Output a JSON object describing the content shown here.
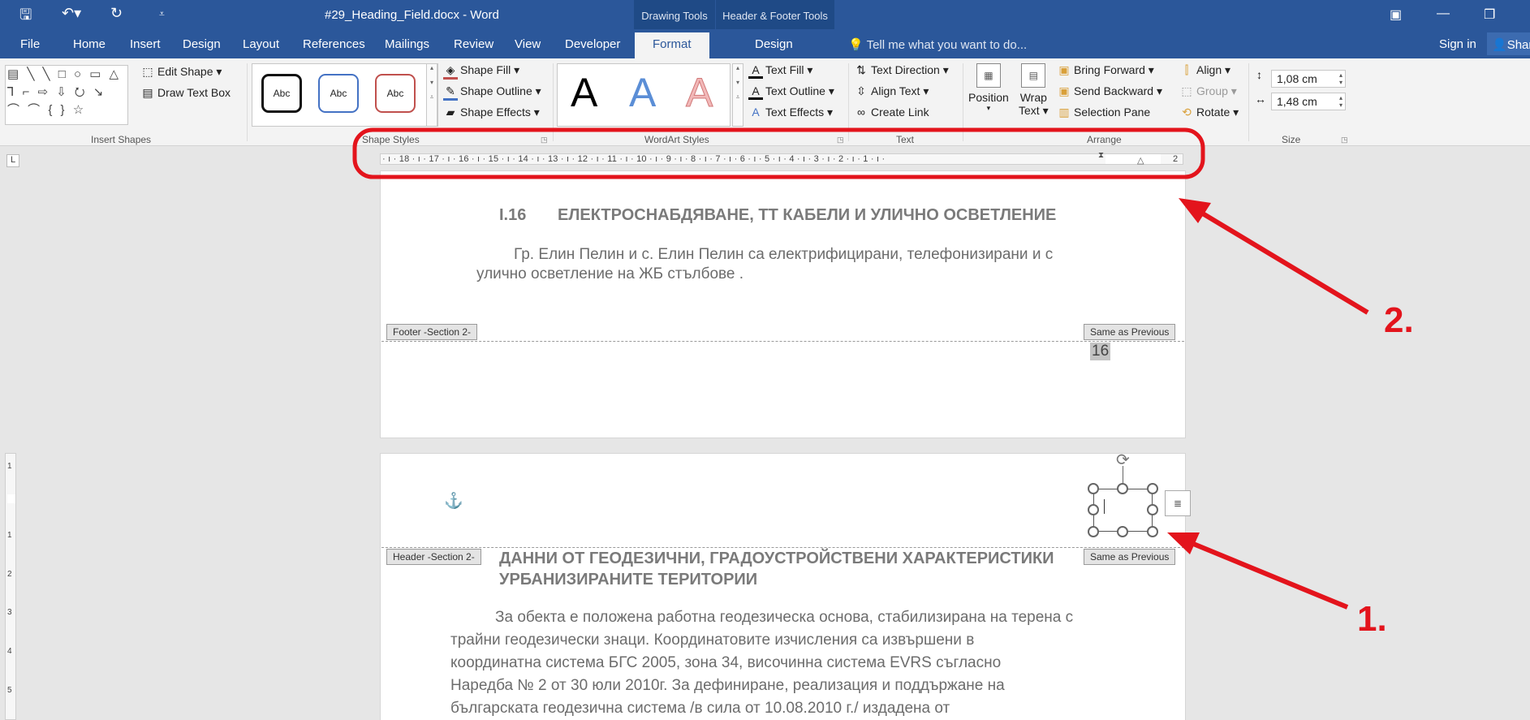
{
  "window": {
    "doc_title": "#29_Heading_Field.docx - Word",
    "drawing_tools": "Drawing Tools",
    "header_footer_tools": "Header & Footer Tools"
  },
  "tabs": [
    "File",
    "Home",
    "Insert",
    "Design",
    "Layout",
    "References",
    "Mailings",
    "Review",
    "View",
    "Developer"
  ],
  "ctx_tabs": {
    "format": "Format",
    "design": "Design"
  },
  "tell_me": "Tell me what you want to do...",
  "sign_in": "Sign in",
  "share": "Shar",
  "ribbon": {
    "insert_shapes": {
      "label": "Insert Shapes",
      "edit_shape": "Edit Shape",
      "draw_text_box": "Draw Text Box",
      "shapes": "▤ ╲ ╲ □ ○ ▭ △ ⅂ ⌐ ⇨ ⇩ ⭮ ↘ ⌒ ⌒ { } ☆"
    },
    "shape_styles": {
      "label": "Shape Styles",
      "abc": "Abc",
      "shape_fill": "Shape Fill",
      "shape_outline": "Shape Outline",
      "shape_effects": "Shape Effects"
    },
    "wordart_styles": {
      "label": "WordArt Styles",
      "a": "A",
      "text_fill": "Text Fill",
      "text_outline": "Text Outline",
      "text_effects": "Text Effects"
    },
    "text": {
      "label": "Text",
      "text_direction": "Text Direction",
      "align_text": "Align Text",
      "create_link": "Create Link"
    },
    "arrange": {
      "label": "Arrange",
      "position": "Position",
      "wrap": "Wrap",
      "wrap2": "Text",
      "bring_forward": "Bring Forward",
      "send_backward": "Send Backward",
      "selection_pane": "Selection Pane",
      "align": "Align",
      "group": "Group",
      "rotate": "Rotate"
    },
    "size": {
      "label": "Size",
      "height": "1,08 cm",
      "width": "1,48 cm"
    }
  },
  "ruler": [
    "· ı · 18 · ı · 17 · ı · 16 · ı · 15 · ı · 14 · ı · 13 · ı · 12 · ı · 11 · ı · 10 · ı · 9 · ı · 8 · ı · 7 · ı · 6 · ı · 5 · ı · 4 · ı · 3 · ı · 2 · ı · 1 · ı ·",
    "2"
  ],
  "vruler": [
    "1",
    "1",
    "2",
    "3",
    "4",
    "5"
  ],
  "corner_tab": "L",
  "page1": {
    "heading_no": "I.16",
    "heading": "ЕЛЕКТРОСНАБДЯВАНЕ, ТТ КАБЕЛИ И УЛИЧНО ОСВЕТЛЕНИЕ",
    "line1": "Гр. Елин Пелин и с. Елин Пелин са електрифицирани, телефонизирани и с",
    "line2": "улично осветление на ЖБ стълбове .",
    "footer_tag": "Footer -Section 2-",
    "same_as_prev": "Same as Previous",
    "page_number": "16"
  },
  "page2": {
    "header_tag": "Header -Section 2-",
    "same_as_prev": "Same as Previous",
    "heading1": "ДАННИ  ОТ  ГЕОДЕЗИЧНИ,  ГРАДОУСТРОЙСТВЕНИ  ХАРАКТЕРИСТИКИ",
    "heading2": "УРБАНИЗИРАНИТЕ ТЕРИТОРИИ",
    "lines": [
      "За обекта  е положена работна геодезическа основа, стабилизирана на терена с",
      "трайни   геодезически   знаци.   Координатовите   изчисления   са   извършени   в",
      "координатна   система   БГС   2005,   зона   34,   височинна   система   EVRS   съгласно",
      "Наредба  №  2  от  30  юли  2010г.  За  дефиниране,  реализация  и  поддържане  на",
      "българската    геодезична    система    /в    сила    от    10.08.2010    г./    издадена    от"
    ]
  },
  "annotations": {
    "one": "1.",
    "two": "2."
  },
  "colors": {
    "ribbon_blue": "#2b579a",
    "annotation_red": "#e3141c"
  }
}
